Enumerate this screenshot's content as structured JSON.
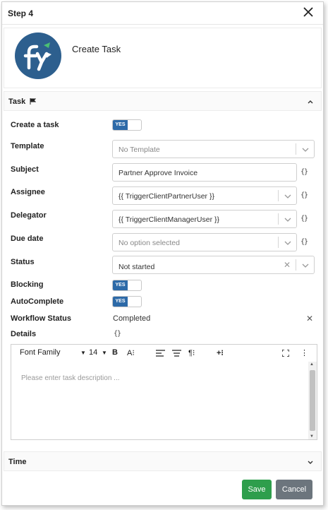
{
  "dialog": {
    "title": "Step 4",
    "close_icon": "close-icon"
  },
  "header": {
    "title": "Create Task",
    "logo_text": "fy"
  },
  "sections": {
    "task": "Task",
    "time": "Time"
  },
  "fields": {
    "create_task": {
      "label": "Create a task",
      "toggle": "YES"
    },
    "template": {
      "label": "Template",
      "value": "No Template"
    },
    "subject": {
      "label": "Subject",
      "value": "Partner Approve Invoice"
    },
    "assignee": {
      "label": "Assignee",
      "value": "{{ TriggerClientPartnerUser }}"
    },
    "delegator": {
      "label": "Delegator",
      "value": "{{ TriggerClientManagerUser }}"
    },
    "due_date": {
      "label": "Due date",
      "value": "No option selected"
    },
    "status": {
      "label": "Status",
      "value": "Not started"
    },
    "blocking": {
      "label": "Blocking",
      "toggle": "YES"
    },
    "autocomplete": {
      "label": "AutoComplete",
      "toggle": "YES"
    },
    "workflow_status": {
      "label": "Workflow Status",
      "value": "Completed"
    },
    "details": {
      "label": "Details"
    }
  },
  "braces": "{}",
  "editor": {
    "font_family": "Font Family",
    "font_size": "14",
    "placeholder": "Please enter task description ..."
  },
  "buttons": {
    "save": "Save",
    "cancel": "Cancel"
  },
  "colors": {
    "accent": "#2d6aa8",
    "save": "#2e9e4c",
    "cancel": "#6c757d",
    "logo": "#2d5f8e"
  }
}
